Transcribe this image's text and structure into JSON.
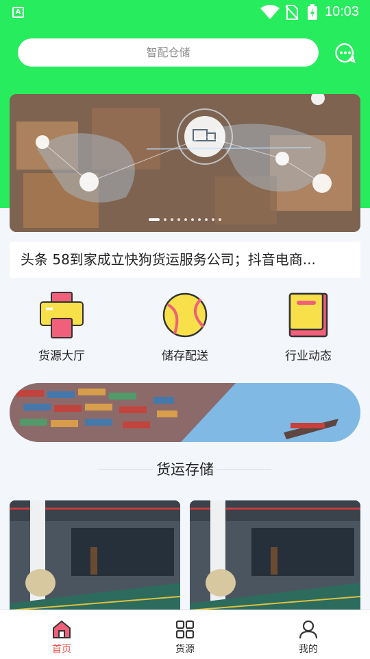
{
  "status_bar": {
    "app_badge": "A",
    "time": "10:03"
  },
  "search": {
    "placeholder": "智配仓储"
  },
  "banner": {
    "slide_count": 10,
    "active_index": 0
  },
  "ticker": {
    "text": "头条 58到家成立快狗货运服务公司；抖音电商..."
  },
  "quick_entries": [
    {
      "label": "货源大厅",
      "icon": "printer-icon"
    },
    {
      "label": "储存配送",
      "icon": "ball-icon"
    },
    {
      "label": "行业动态",
      "icon": "book-icon"
    }
  ],
  "section": {
    "title": "货运存储"
  },
  "tabbar": {
    "tabs": [
      {
        "label": "首页",
        "icon": "home-icon",
        "active": true
      },
      {
        "label": "货源",
        "icon": "grid-icon",
        "active": false
      },
      {
        "label": "我的",
        "icon": "user-icon",
        "active": false
      }
    ]
  },
  "colors": {
    "header_green": "#27ec5d",
    "accent_red": "#e8514a",
    "page_bg": "#f3f6fb"
  }
}
